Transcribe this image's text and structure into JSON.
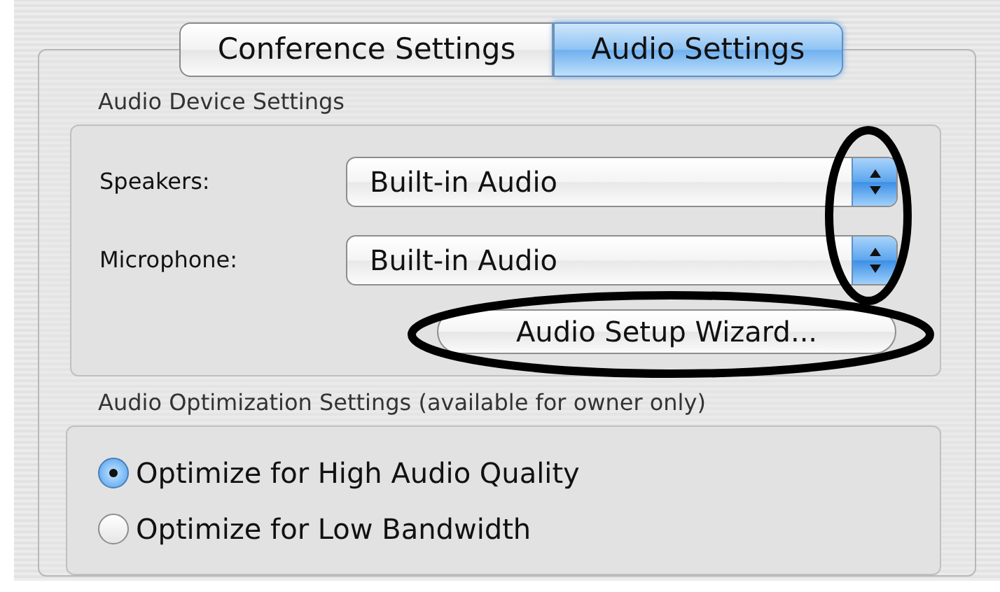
{
  "tabs": [
    {
      "label": "Conference Settings",
      "selected": false
    },
    {
      "label": "Audio Settings",
      "selected": true
    }
  ],
  "audio_device_settings": {
    "title": "Audio Device Settings",
    "fields": [
      {
        "label": "Speakers:",
        "value": "Built-in Audio"
      },
      {
        "label": "Microphone:",
        "value": "Built-in Audio"
      }
    ],
    "button": "Audio Setup Wizard..."
  },
  "audio_optimization_settings": {
    "title": "Audio Optimization Settings (available for owner only)",
    "options": [
      {
        "label": "Optimize for High Audio Quality",
        "selected": true
      },
      {
        "label": "Optimize for Low Bandwidth",
        "selected": false
      }
    ]
  }
}
